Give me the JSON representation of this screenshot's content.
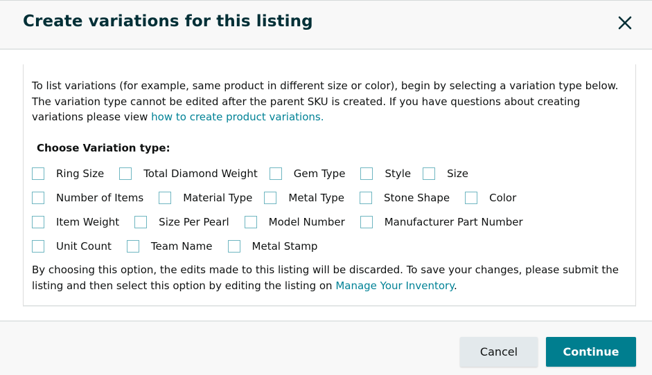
{
  "dialog": {
    "title": "Create variations for this listing",
    "close_icon": "close-icon"
  },
  "intro": {
    "text": "To list variations (for example, same product in different size or color), begin by selecting a variation type below. The variation type cannot be edited after the parent SKU is created. If you have questions about creating variations please view ",
    "link_text": "how to create product variations."
  },
  "variation": {
    "heading": "Choose Variation type:",
    "rows": [
      [
        {
          "label": "Ring Size",
          "checked": false
        },
        {
          "label": "Total Diamond Weight",
          "checked": false
        },
        {
          "label": "Gem Type",
          "checked": false
        },
        {
          "label": "Style",
          "checked": false
        },
        {
          "label": "Size",
          "checked": false
        }
      ],
      [
        {
          "label": "Number of Items",
          "checked": false
        },
        {
          "label": "Material Type",
          "checked": false
        },
        {
          "label": "Metal Type",
          "checked": false
        },
        {
          "label": "Stone Shape",
          "checked": false
        },
        {
          "label": "Color",
          "checked": false
        }
      ],
      [
        {
          "label": "Item Weight",
          "checked": false
        },
        {
          "label": "Size Per Pearl",
          "checked": false
        },
        {
          "label": "Model Number",
          "checked": false
        },
        {
          "label": "Manufacturer Part Number",
          "checked": false
        }
      ],
      [
        {
          "label": "Unit Count",
          "checked": false
        },
        {
          "label": "Team Name",
          "checked": false
        },
        {
          "label": "Metal Stamp",
          "checked": false
        }
      ]
    ]
  },
  "note": {
    "text": "By choosing this option, the edits made to this listing will be discarded. To save your changes, please submit the listing and then select this option by editing the listing on ",
    "link_text": "Manage Your Inventory",
    "suffix": "."
  },
  "footer": {
    "cancel_label": "Cancel",
    "continue_label": "Continue"
  },
  "colors": {
    "accent": "#007e8f",
    "link": "#008296",
    "title": "#002f36"
  }
}
